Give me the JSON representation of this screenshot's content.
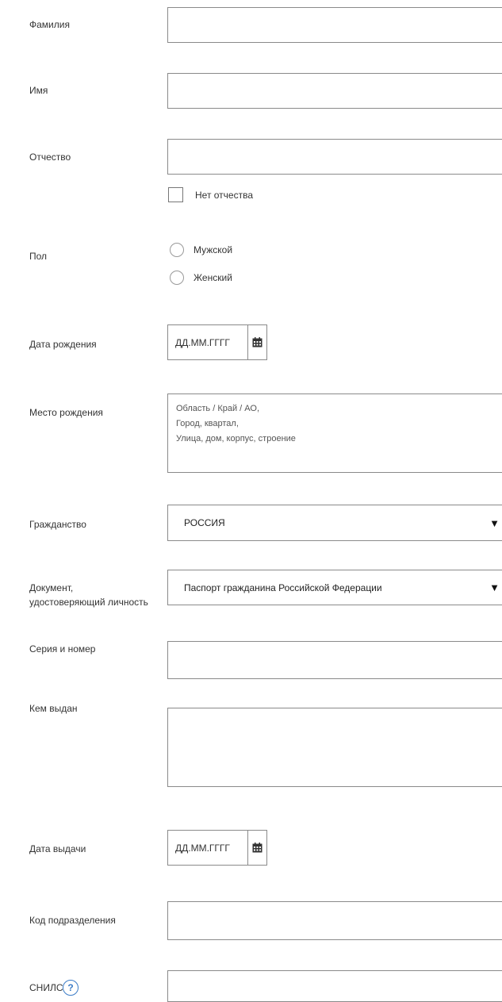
{
  "fields": {
    "surname": {
      "label": "Фамилия",
      "value": ""
    },
    "name": {
      "label": "Имя",
      "value": ""
    },
    "patronymic": {
      "label": "Отчество",
      "value": "",
      "no_patronymic_label": "Нет отчества"
    },
    "gender": {
      "label": "Пол",
      "options": [
        "Мужской",
        "Женский"
      ]
    },
    "birth_date": {
      "label": "Дата рождения",
      "placeholder": "ДД.ММ.ГГГГ"
    },
    "birth_place": {
      "label": "Место рождения",
      "placeholder_lines": [
        "Область / Край / АО,",
        "Город, квартал,",
        "Улица, дом, корпус, строение"
      ]
    },
    "citizenship": {
      "label": "Гражданство",
      "selected": "РОССИЯ"
    },
    "id_document": {
      "label_line1": "Документ,",
      "label_line2": "удостоверяющий личность",
      "selected": "Паспорт гражданина Российской Федерации"
    },
    "series_number": {
      "label": "Серия и номер",
      "value": ""
    },
    "issued_by": {
      "label": "Кем выдан",
      "value": ""
    },
    "issue_date": {
      "label": "Дата выдачи",
      "placeholder": "ДД.ММ.ГГГГ"
    },
    "division_code": {
      "label": "Код подразделения",
      "value": ""
    },
    "snils": {
      "label": "СНИЛС",
      "help_glyph": "?"
    }
  },
  "icons": {
    "calendar": "calendar-icon",
    "dropdown": "triangle-down-icon"
  }
}
